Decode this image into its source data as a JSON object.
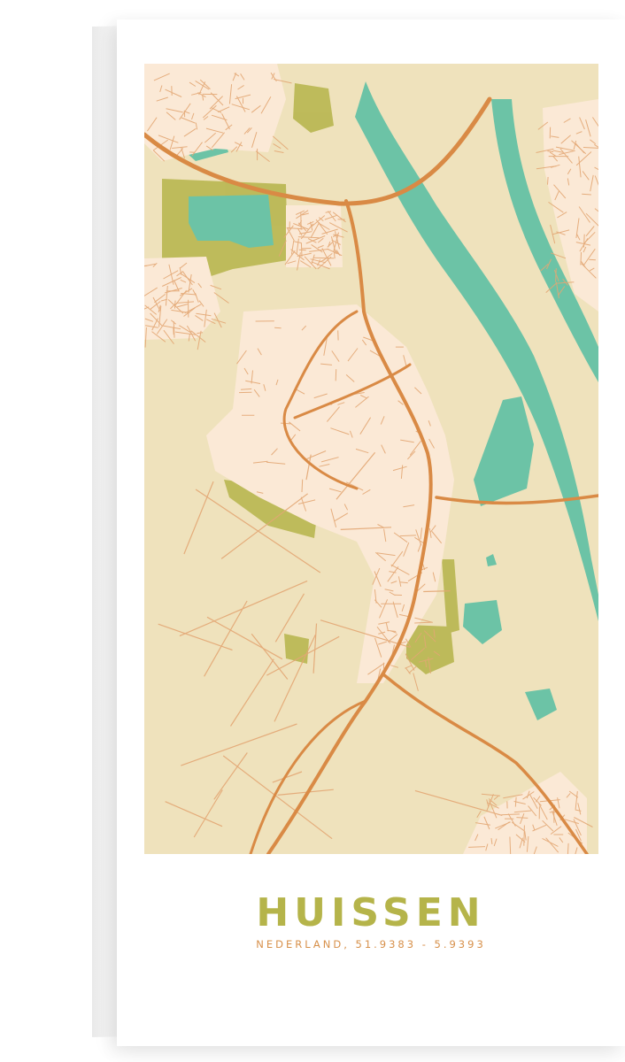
{
  "poster": {
    "city": "HUISSEN",
    "subtitle": "NEDERLAND, 51.9383 - 5.9393"
  },
  "colors": {
    "land": "#efe2bc",
    "urban": "#fbe9d6",
    "road": "#d98a45",
    "minor_road": "#e3a774",
    "water": "#6cc3a6",
    "green": "#b5b44a",
    "title": "#b5b44a",
    "subtitle": "#d7904a"
  },
  "map": {
    "layers": [
      "land",
      "parks",
      "water",
      "urban-areas",
      "roads"
    ],
    "icons": [
      "river-icon",
      "lake-icon",
      "motorway-icon"
    ]
  }
}
